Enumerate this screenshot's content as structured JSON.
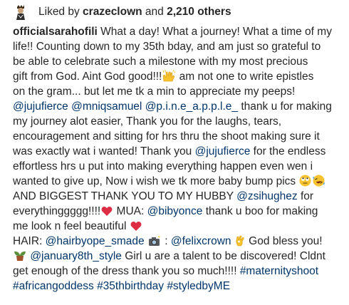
{
  "likes": {
    "prefix": "Liked by",
    "liker": "crazeclown",
    "joiner": "and",
    "count_text": "2,210 others"
  },
  "caption": {
    "username": "officialsarahofili",
    "l1": " What a day! What a journey! What a time of my",
    "l2": "life!! Counting down to my 35th bday, and am just so grateful to",
    "l3": "be able to celebrate such a milestone with my most precious",
    "l4": "gift from God. Aint God good!!!",
    "l4b": " am not one to write epistles",
    "l5": "on the gram... but let me tk a min to appreciate my peeps!",
    "l6_m1": "@jujufierce",
    "l6_m2": "@mniqsamuel",
    "l6_m3": "@p.i.n.e_a.p.p.l.e_",
    "l6_t": " thank u for making",
    "l7": "my journey alot easier, Thank you for the laughs, tears,",
    "l8": "encouragement and sitting for hrs thru the shoot making sure it",
    "l9a": "was exactly wat i wanted! Thank you ",
    "l9_m": "@jujufierce",
    "l9b": " for the endless",
    "l10": "effortless hrs u put into making everything happen even wen i",
    "l11": "wanted to give up, Now i wish we tk more baby bump pics ",
    "l12a": "AND BIGGEST THANK YOU TO MY HUBBY ",
    "l12_m": "@zsihughez",
    "l12b": " for",
    "l13a": "everythinggggg!!!!",
    "l13b": " MUA: ",
    "l13_m": "@bibyonce",
    "l13c": " thank u boo for making",
    "l14": "me look n feel beautiful ",
    "l15a": "HAIR: ",
    "l15_m1": "@hairbyope_smade",
    "l15_m2": "@felixcrown",
    "l15b": " God bless you!",
    "l16_m": "@january8th_style",
    "l16b": " Girl u are a talent to be discovered! Cldnt",
    "l17a": "get enough of the dress thank you so much!!!! ",
    "l17_h1": "#maternityshoot",
    "l18_h1": "#africangoddess",
    "l18_h2": "#35thbirthday",
    "l18_h3": "#styledbyME"
  },
  "icons": [
    "liker-avatar-icon",
    "raised-hands-emoji-icon",
    "rolling-eyes-emoji-icon",
    "rofl-emoji-icon",
    "red-heart-emoji-icon",
    "camera-flash-emoji-icon",
    "ok-hand-emoji-icon",
    "potted-plant-emoji-icon"
  ],
  "colors": {
    "text": "#262626",
    "link": "#003569"
  }
}
